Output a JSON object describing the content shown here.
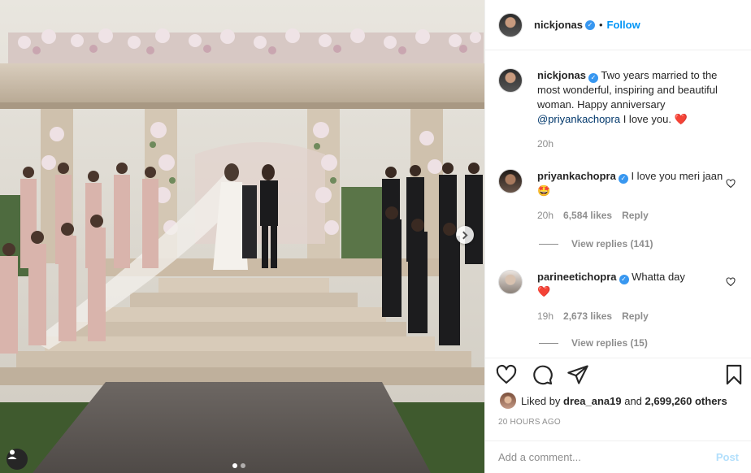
{
  "post": {
    "author": "nickjonas",
    "follow_label": "Follow",
    "separator": "•",
    "verified_icon": "verified-badge-icon",
    "carousel": {
      "total": 2,
      "active_index": 0
    }
  },
  "caption": {
    "username": "nickjonas",
    "text_before": "Two years married to the most wonderful, inspiring and beautiful woman. Happy anniversary ",
    "mention": "@priyankachopra",
    "text_after": " I love you. ",
    "emoji": "❤️",
    "time": "20h"
  },
  "comments": [
    {
      "username": "priyankachopra",
      "text": "I love you meri jaan ",
      "emoji": "🤩",
      "time": "20h",
      "likes": "6,584 likes",
      "reply_label": "Reply",
      "view_replies": "View replies (141)"
    },
    {
      "username": "parineetichopra",
      "text": "Whatta day ",
      "emoji": "❤️",
      "time": "19h",
      "likes": "2,673 likes",
      "reply_label": "Reply",
      "view_replies": "View replies (15)"
    }
  ],
  "likes": {
    "prefix": "Liked by ",
    "first_user": "drea_ana19",
    "middle": " and ",
    "others": "2,699,260 others"
  },
  "posted": "20 HOURS AGO",
  "composer": {
    "placeholder": "Add a comment...",
    "post_label": "Post"
  },
  "colors": {
    "accent": "#0095f6",
    "verified": "#3897f0",
    "post_disabled": "#b2dffc",
    "heart": "#ed4956"
  }
}
